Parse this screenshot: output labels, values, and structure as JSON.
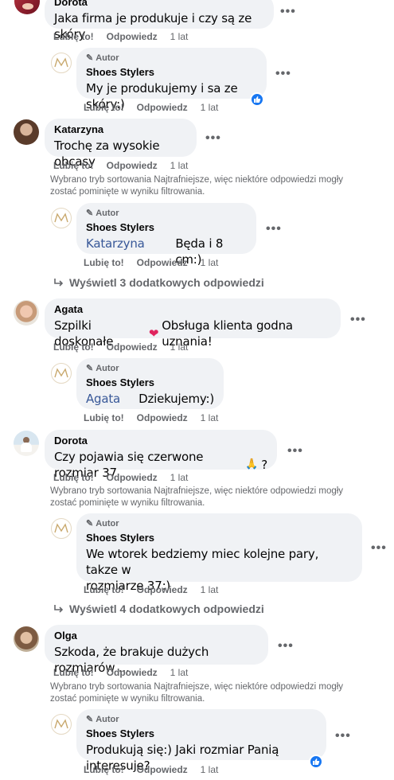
{
  "actions": {
    "like": "Lubię to!",
    "reply": "Odpowiedz",
    "time": "1 lat"
  },
  "badges": {
    "author": "Autor"
  },
  "page_name": "Shoes Stylers",
  "filter_note_line1": "Wybrano tryb sortowania Najtrafniejsze, więc niektóre odpowiedzi mogły",
  "filter_note_line2": "zostać pominięte w wyniku filtrowania.",
  "comments": [
    {
      "author": "Dorota",
      "text": "Jaka firma je produkuje i czy są ze skóry",
      "reply": {
        "text": "My je produkujemy i sa ze skóry:)"
      }
    },
    {
      "author": "Katarzyna",
      "text": "Trochę za wysokie obcasy",
      "reply": {
        "mention": "Katarzyna",
        "text": "Będa i 8 cm:)"
      },
      "more_replies": "Wyświetl 3 dodatkowych odpowiedzi"
    },
    {
      "author": "Agata",
      "text": "Szpilki doskonałe",
      "text2": "Obsługa klienta godna uznania!",
      "reply": {
        "mention": "Agata",
        "text": "Dziekujemy:)"
      }
    },
    {
      "author": "Dorota",
      "text": "Czy pojawia się czerwone rozmiar 37",
      "text_end": "?",
      "reply": {
        "text": "We wtorek bedziemy miec kolejne pary, takze w",
        "text_line2": "rozmiarze 37:)"
      },
      "more_replies": "Wyświetl 4 dodatkowych odpowiedzi"
    },
    {
      "author": "Olga",
      "text": "Szkoda, że brakuje dużych rozmiarów ...",
      "reply": {
        "text": "Produkują się:) Jaki rozmiar Panią interesuje?"
      }
    }
  ],
  "colors": {
    "bubble": "#f0f2f5",
    "meta": "#65676b",
    "mention": "#385898",
    "like": "#1877f2",
    "heart": "#e0245e"
  },
  "icons": [
    "pencil-icon",
    "more-dots-icon",
    "reply-arrow-icon",
    "thumbs-up-icon",
    "heart-emoji",
    "praying-hands-emoji"
  ]
}
